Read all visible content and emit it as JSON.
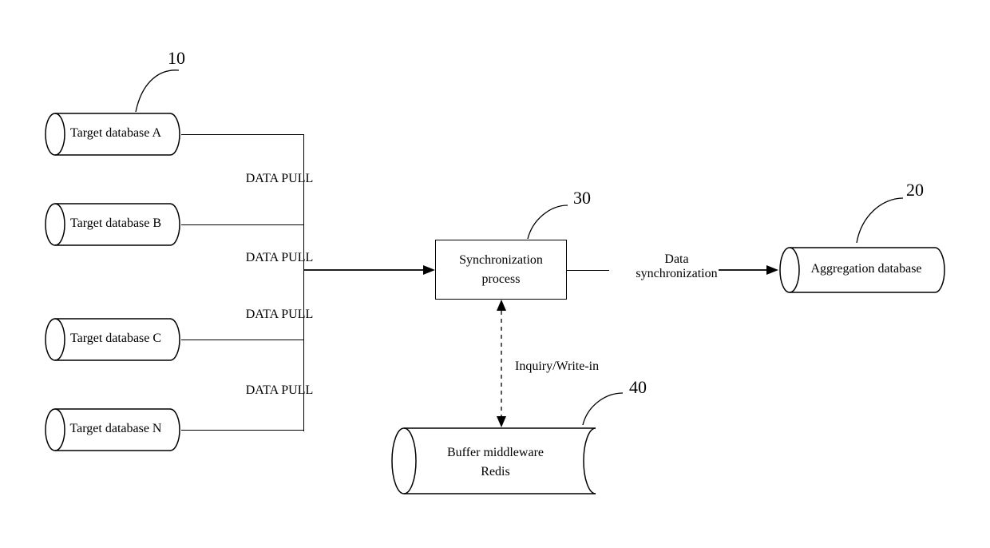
{
  "ref": {
    "databases": "10",
    "aggregation": "20",
    "sync": "30",
    "buffer": "40"
  },
  "databases": {
    "a": "Target database A",
    "b": "Target database B",
    "c": "Target database C",
    "n": "Target database N"
  },
  "sync_box": "Synchronization\nprocess",
  "buffer_box": "Buffer middleware\nRedis",
  "aggregation": "Aggregation database",
  "edge": {
    "data_pull": "DATA PULL",
    "inquiry": "Inquiry/Write-in",
    "data_sync": "Data\nsynchronization"
  }
}
